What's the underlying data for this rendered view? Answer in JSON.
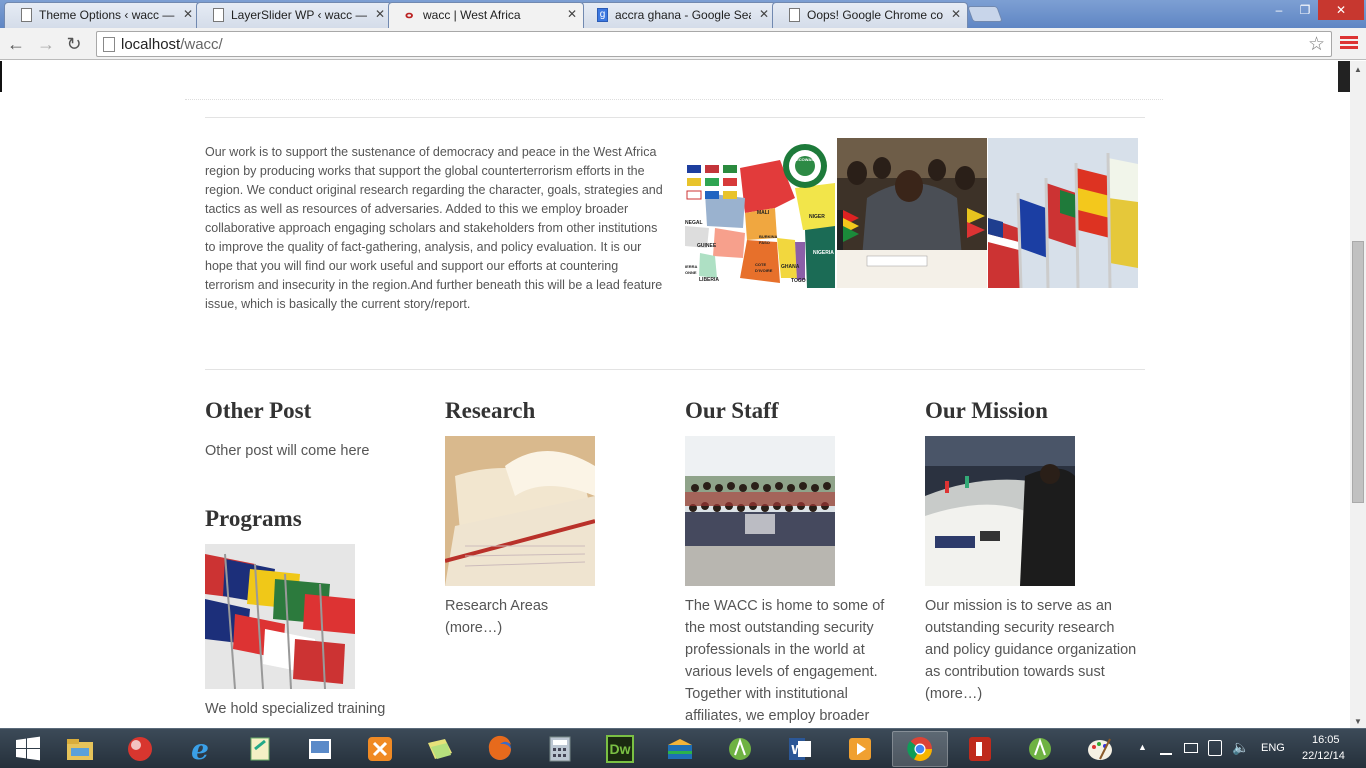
{
  "browser": {
    "tabs": [
      {
        "title": "Theme Options ‹ wacc —",
        "favicon": "page-icon"
      },
      {
        "title": "LayerSlider WP ‹ wacc — V",
        "favicon": "page-icon"
      },
      {
        "title": "wacc | West Africa",
        "favicon": "wacc-icon",
        "active": true
      },
      {
        "title": "accra ghana - Google Sea",
        "favicon": "google-icon"
      },
      {
        "title": "Oops! Google Chrome cou",
        "favicon": "page-icon"
      }
    ],
    "tab_close": "✕",
    "url_host": "localhost",
    "url_path": "/wacc/",
    "window_controls": {
      "minimize": "–",
      "restore": "❐",
      "close": "✕"
    }
  },
  "page": {
    "intro": "Our work is to support the sustenance of democracy and peace in the West Africa region by producing works that support the global counterterrorism efforts in the region. We conduct original research regarding the character, goals, strategies and tactics as well as resources of adversaries. Added to this we employ broader collaborative approach engaging scholars and stakeholders from other institutions to improve the quality of fact-gathering, analysis, and policy evaluation. It is our hope that you will find our work useful and support our efforts at countering terrorism and insecurity in the region.And further beneath this will be a lead feature issue, which is basically the current story/report.",
    "map_labels": {
      "mali": "MALI",
      "niger": "NIGER",
      "nigeria": "NIGERIA",
      "burkina": "BURKINA FASO",
      "ghana": "GHANA",
      "togo": "TOGO",
      "cote": "COTE D'IVOIRE",
      "guinee": "GUINEE",
      "liberia": "LIBERIA",
      "senegal": "NEGAL",
      "sierra": "IERRA ONNE"
    },
    "ecowas_badge": "CEDEAO ECOWAS",
    "columns": [
      {
        "title": "Other Post",
        "text": "Other post will come here"
      },
      {
        "title": "Research",
        "text": "Research Areas",
        "more": "(more…)"
      },
      {
        "title": "Our Staff",
        "text": "The WACC is home to some of the most outstanding security professionals in the world at various levels of engagement. Together with institutional affiliates, we employ broader"
      },
      {
        "title": "Our Mission",
        "text": "Our mission is to serve as an outstanding security research and policy guidance organization as contribution towards sust",
        "more": "(more…)"
      }
    ],
    "programs": {
      "title": "Programs",
      "text": "We hold specialized training"
    }
  },
  "taskbar": {
    "apps": [
      "start-icon",
      "file-explorer-icon",
      "ball-app-icon",
      "internet-explorer-icon",
      "notepad-plus-icon",
      "image-viewer-icon",
      "xampp-icon",
      "sticky-notes-icon",
      "firefox-icon",
      "calculator-icon",
      "dreamweaver-icon",
      "box-app-icon",
      "android-studio-icon",
      "word-icon",
      "media-player-icon",
      "chrome-icon",
      "filezilla-icon",
      "android-icon",
      "paint-icon"
    ],
    "dreamweaver_label": "Dw",
    "language": "ENG",
    "time": "16:05",
    "date": "22/12/14",
    "tray_arrow": "▲"
  }
}
